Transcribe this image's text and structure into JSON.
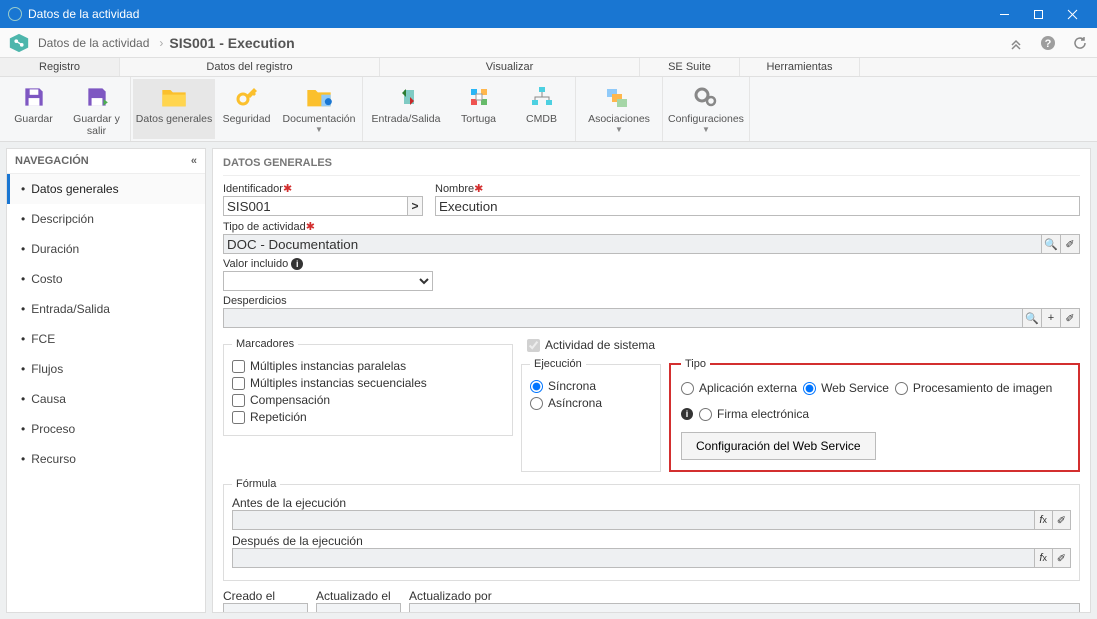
{
  "window": {
    "title": "Datos de la actividad"
  },
  "breadcrumb": {
    "parent": "Datos de la actividad",
    "current": "SIS001 - Execution"
  },
  "tabs": [
    "Registro",
    "Datos del registro",
    "Visualizar",
    "SE Suite",
    "Herramientas"
  ],
  "tabWidths": [
    120,
    260,
    260,
    100,
    120
  ],
  "ribbon": {
    "guardar": "Guardar",
    "guardar_salir": "Guardar y salir",
    "datos_generales": "Datos generales",
    "seguridad": "Seguridad",
    "documentacion": "Documentación",
    "entrada_salida": "Entrada/Salida",
    "tortuga": "Tortuga",
    "cmdb": "CMDB",
    "asociaciones": "Asociaciones",
    "configuraciones": "Configuraciones"
  },
  "nav": {
    "header": "NAVEGACIÓN",
    "items": [
      "Datos generales",
      "Descripción",
      "Duración",
      "Costo",
      "Entrada/Salida",
      "FCE",
      "Flujos",
      "Causa",
      "Proceso",
      "Recurso"
    ]
  },
  "pane": {
    "header": "DATOS GENERALES",
    "identificador": {
      "label": "Identificador",
      "value": "SIS001"
    },
    "nombre": {
      "label": "Nombre",
      "value": "Execution"
    },
    "tipo_actividad": {
      "label": "Tipo de actividad",
      "value": "DOC - Documentation"
    },
    "valor_incluido": {
      "label": "Valor incluido"
    },
    "desperdicios": {
      "label": "Desperdicios"
    },
    "marcadores": {
      "legend": "Marcadores",
      "o1": "Múltiples instancias paralelas",
      "o2": "Múltiples instancias secuenciales",
      "o3": "Compensación",
      "o4": "Repetición"
    },
    "act_sistema": "Actividad de sistema",
    "ejecucion": {
      "legend": "Ejecución",
      "sincrona": "Síncrona",
      "asincrona": "Asíncrona"
    },
    "tipo": {
      "legend": "Tipo",
      "app": "Aplicación externa",
      "ws": "Web Service",
      "img": "Procesamiento de imagen",
      "sig": "Firma electrónica",
      "button": "Configuración del Web Service"
    },
    "formula": {
      "legend": "Fórmula",
      "antes": "Antes de la ejecución",
      "despues": "Después de la ejecución"
    },
    "creado": {
      "creado_el": "Creado el",
      "actualizado_el": "Actualizado el",
      "actualizado_por": "Actualizado por"
    }
  }
}
